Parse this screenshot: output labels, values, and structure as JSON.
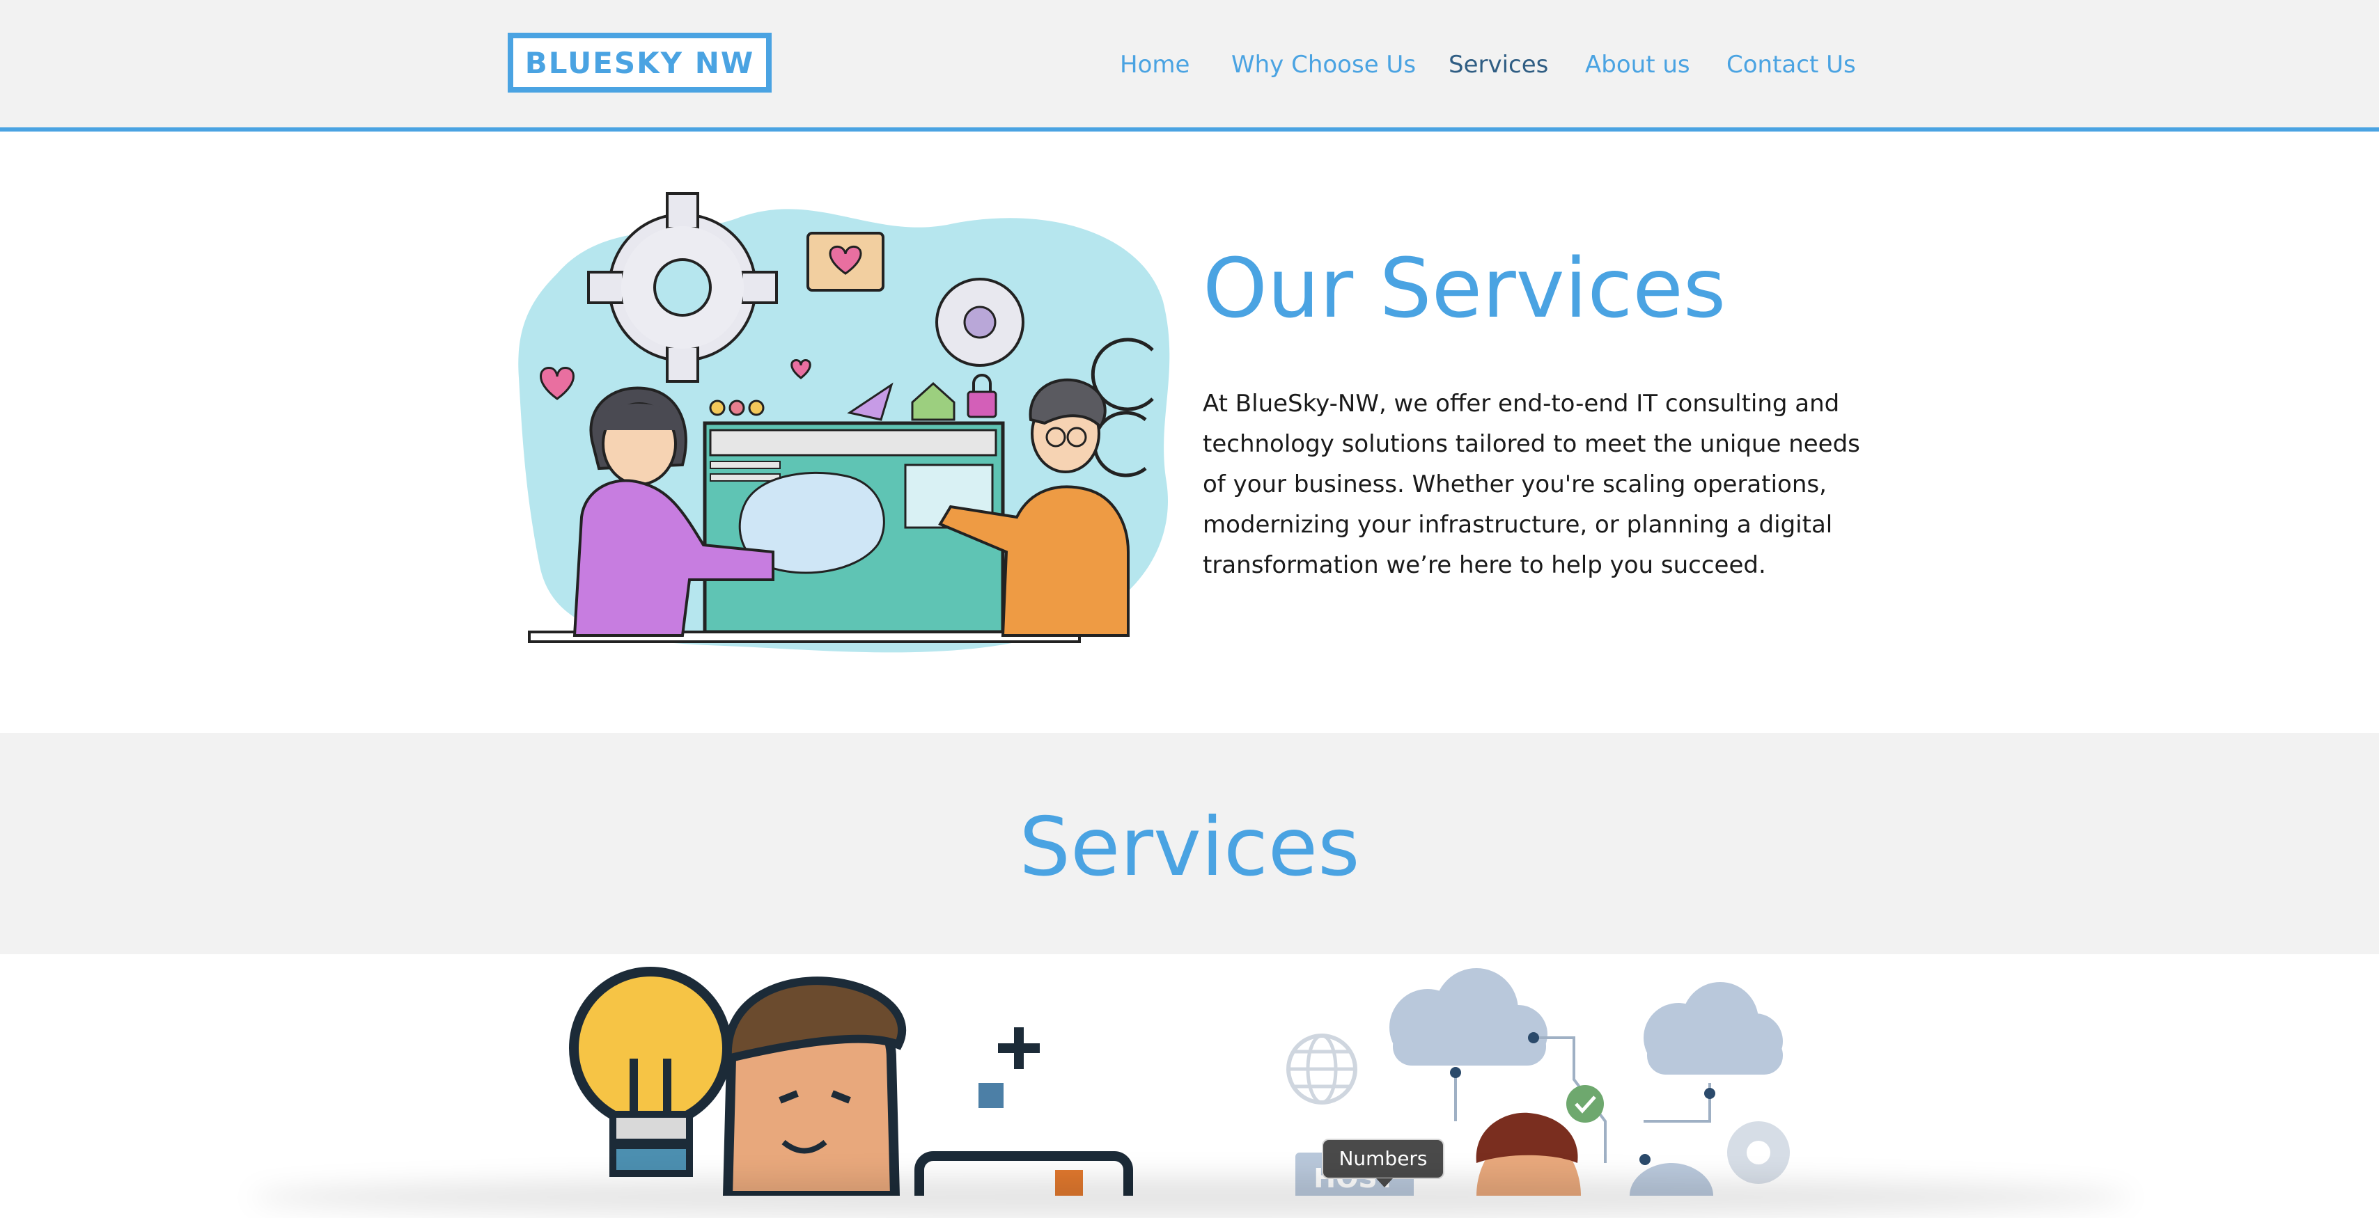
{
  "header": {
    "logo_text": "BLUESKY NW",
    "nav": [
      {
        "label": "Home"
      },
      {
        "label": "Why Choose Us"
      },
      {
        "label": "Services",
        "active": true
      },
      {
        "label": "About us"
      },
      {
        "label": "Contact Us"
      }
    ]
  },
  "hero": {
    "title": "Our Services",
    "body": "At BlueSky-NW, we offer end-to-end IT consulting and technology solutions tailored to meet the unique needs of your business. Whether you're scaling operations, modernizing your infrastructure, or planning a digital transformation we’re here to help you succeed."
  },
  "services_section": {
    "title": "Services",
    "tooltip": "Numbers",
    "card_label_partial": "HOST"
  },
  "colors": {
    "accent": "#4aa3e2",
    "active_nav": "#2f5d83",
    "header_bg": "#f2f2f2",
    "text": "#1a1a1a"
  }
}
